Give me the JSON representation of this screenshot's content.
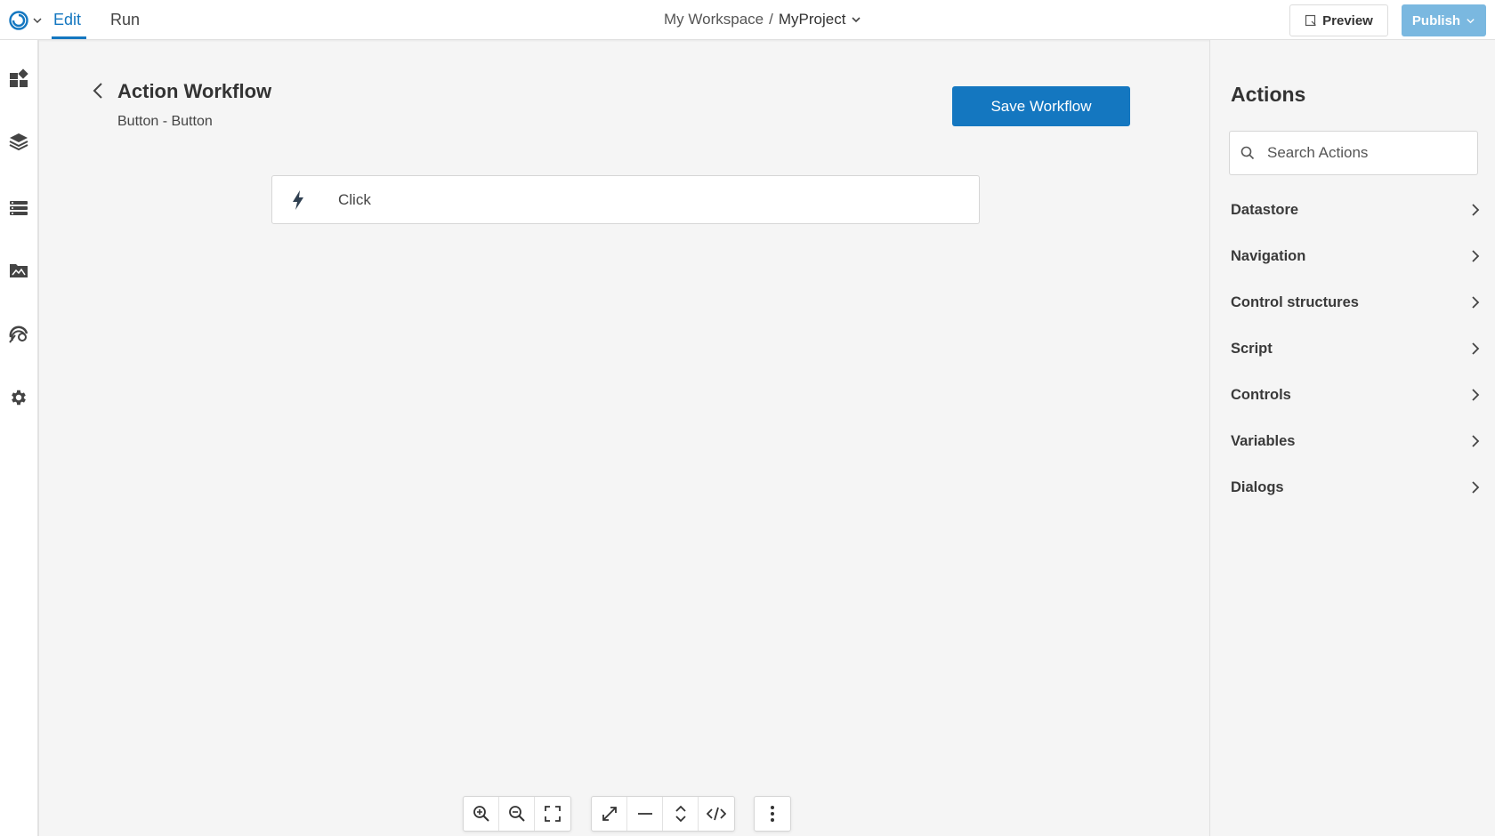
{
  "header": {
    "tabs": [
      {
        "label": "Edit",
        "active": true
      },
      {
        "label": "Run",
        "active": false
      }
    ],
    "breadcrumb": {
      "workspace": "My Workspace",
      "separator": "/",
      "project": "MyProject"
    },
    "preview_label": "Preview",
    "publish_label": "Publish"
  },
  "sidebar": {
    "icons": [
      "dashboard-icon",
      "layers-icon",
      "list-icon",
      "image-icon",
      "api-icon",
      "settings-icon"
    ]
  },
  "workflow": {
    "title": "Action Workflow",
    "subtitle": "Button - Button",
    "save_label": "Save Workflow",
    "trigger": {
      "label": "Click",
      "icon": "bolt-icon"
    }
  },
  "toolbar": {
    "groups": [
      [
        "zoom-in-icon",
        "zoom-out-icon",
        "fit-screen-icon"
      ],
      [
        "expand-icon",
        "collapse-line-icon",
        "expand-vertical-icon",
        "code-icon"
      ],
      [
        "more-vertical-icon"
      ]
    ]
  },
  "actions_panel": {
    "title": "Actions",
    "search_placeholder": "Search Actions",
    "categories": [
      "Datastore",
      "Navigation",
      "Control structures",
      "Script",
      "Controls",
      "Variables",
      "Dialogs"
    ]
  },
  "colors": {
    "accent": "#1477c0",
    "publish_disabled": "#7ab8e0",
    "background": "#f5f5f5"
  }
}
